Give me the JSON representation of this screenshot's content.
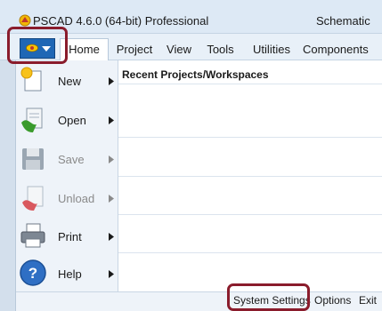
{
  "window": {
    "title": "PSCAD 4.6.0 (64-bit) Professional",
    "title_right": "Schematic",
    "app_icon": "pscad-logo-icon"
  },
  "ribbon": {
    "file_button_icon": "pscad-eye-icon",
    "tabs": [
      {
        "label": "Home",
        "active": true
      },
      {
        "label": "Project",
        "active": false
      },
      {
        "label": "View",
        "active": false
      },
      {
        "label": "Tools",
        "active": false
      },
      {
        "label": "Utilities",
        "active": false
      },
      {
        "label": "Components",
        "active": false
      }
    ]
  },
  "file_menu": {
    "items": [
      {
        "label": "New",
        "icon": "new-sun-icon",
        "enabled": true,
        "has_submenu": true
      },
      {
        "label": "Open",
        "icon": "open-folder-icon",
        "enabled": true,
        "has_submenu": true
      },
      {
        "label": "Save",
        "icon": "save-floppy-icon",
        "enabled": false,
        "has_submenu": true
      },
      {
        "label": "Unload",
        "icon": "unload-icon",
        "enabled": false,
        "has_submenu": true
      },
      {
        "label": "Print",
        "icon": "printer-icon",
        "enabled": true,
        "has_submenu": true
      },
      {
        "label": "Help",
        "icon": "help-icon",
        "enabled": true,
        "has_submenu": true
      }
    ],
    "recent_header": "Recent Projects/Workspaces"
  },
  "bottom_bar": {
    "system_settings": "System Settings",
    "options": "Options",
    "exit": "Exit"
  },
  "colors": {
    "highlight": "#8a1c2c",
    "file_button": "#1f67b5",
    "menu_background": "#eef3f9"
  }
}
